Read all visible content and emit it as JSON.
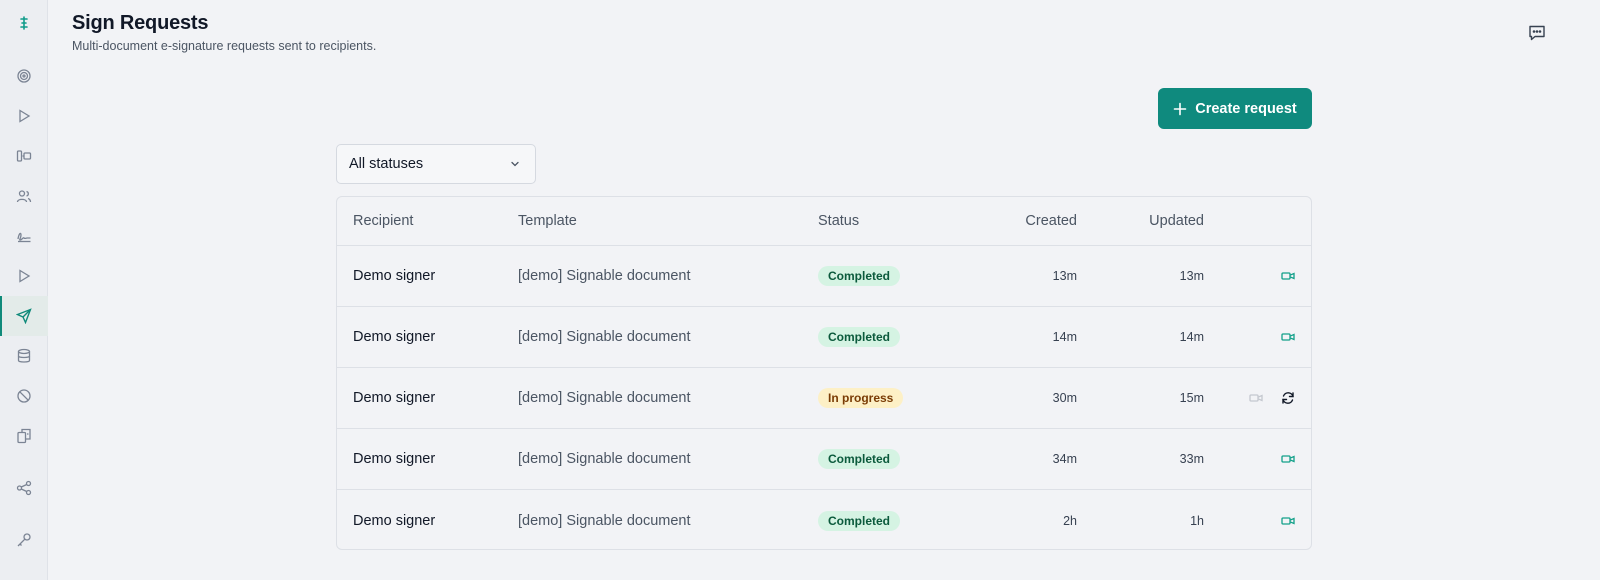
{
  "header": {
    "title": "Sign Requests",
    "subtitle": "Multi-document e-signature requests sent to recipients."
  },
  "sidebar": {
    "items": [
      {
        "icon": "target-icon"
      },
      {
        "icon": "play-icon"
      },
      {
        "icon": "columns-icon"
      },
      {
        "icon": "users-icon"
      },
      {
        "icon": "signature-icon"
      },
      {
        "icon": "play-icon"
      },
      {
        "icon": "send-icon",
        "active": true
      },
      {
        "icon": "database-icon"
      },
      {
        "icon": "ban-icon"
      },
      {
        "icon": "copy-icon"
      },
      {
        "icon": "share-icon"
      },
      {
        "icon": "key-icon"
      }
    ]
  },
  "toolbar": {
    "create_label": "Create request",
    "status_filter": "All statuses"
  },
  "table": {
    "columns": [
      "Recipient",
      "Template",
      "Status",
      "Created",
      "Updated"
    ],
    "rows": [
      {
        "recipient": "Demo signer",
        "template": "[demo] Signable document",
        "status": "Completed",
        "created": "13m",
        "updated": "13m"
      },
      {
        "recipient": "Demo signer",
        "template": "[demo] Signable document",
        "status": "Completed",
        "created": "14m",
        "updated": "14m"
      },
      {
        "recipient": "Demo signer",
        "template": "[demo] Signable document",
        "status": "In progress",
        "created": "30m",
        "updated": "15m"
      },
      {
        "recipient": "Demo signer",
        "template": "[demo] Signable document",
        "status": "Completed",
        "created": "34m",
        "updated": "33m"
      },
      {
        "recipient": "Demo signer",
        "template": "[demo] Signable document",
        "status": "Completed",
        "created": "2h",
        "updated": "1h"
      }
    ]
  },
  "colors": {
    "accent": "#0f8a7e",
    "completed_bg": "#d5f3e3",
    "completed_text": "#0b5a3c",
    "progress_bg": "#fdf0c6",
    "progress_text": "#7a3c05"
  }
}
